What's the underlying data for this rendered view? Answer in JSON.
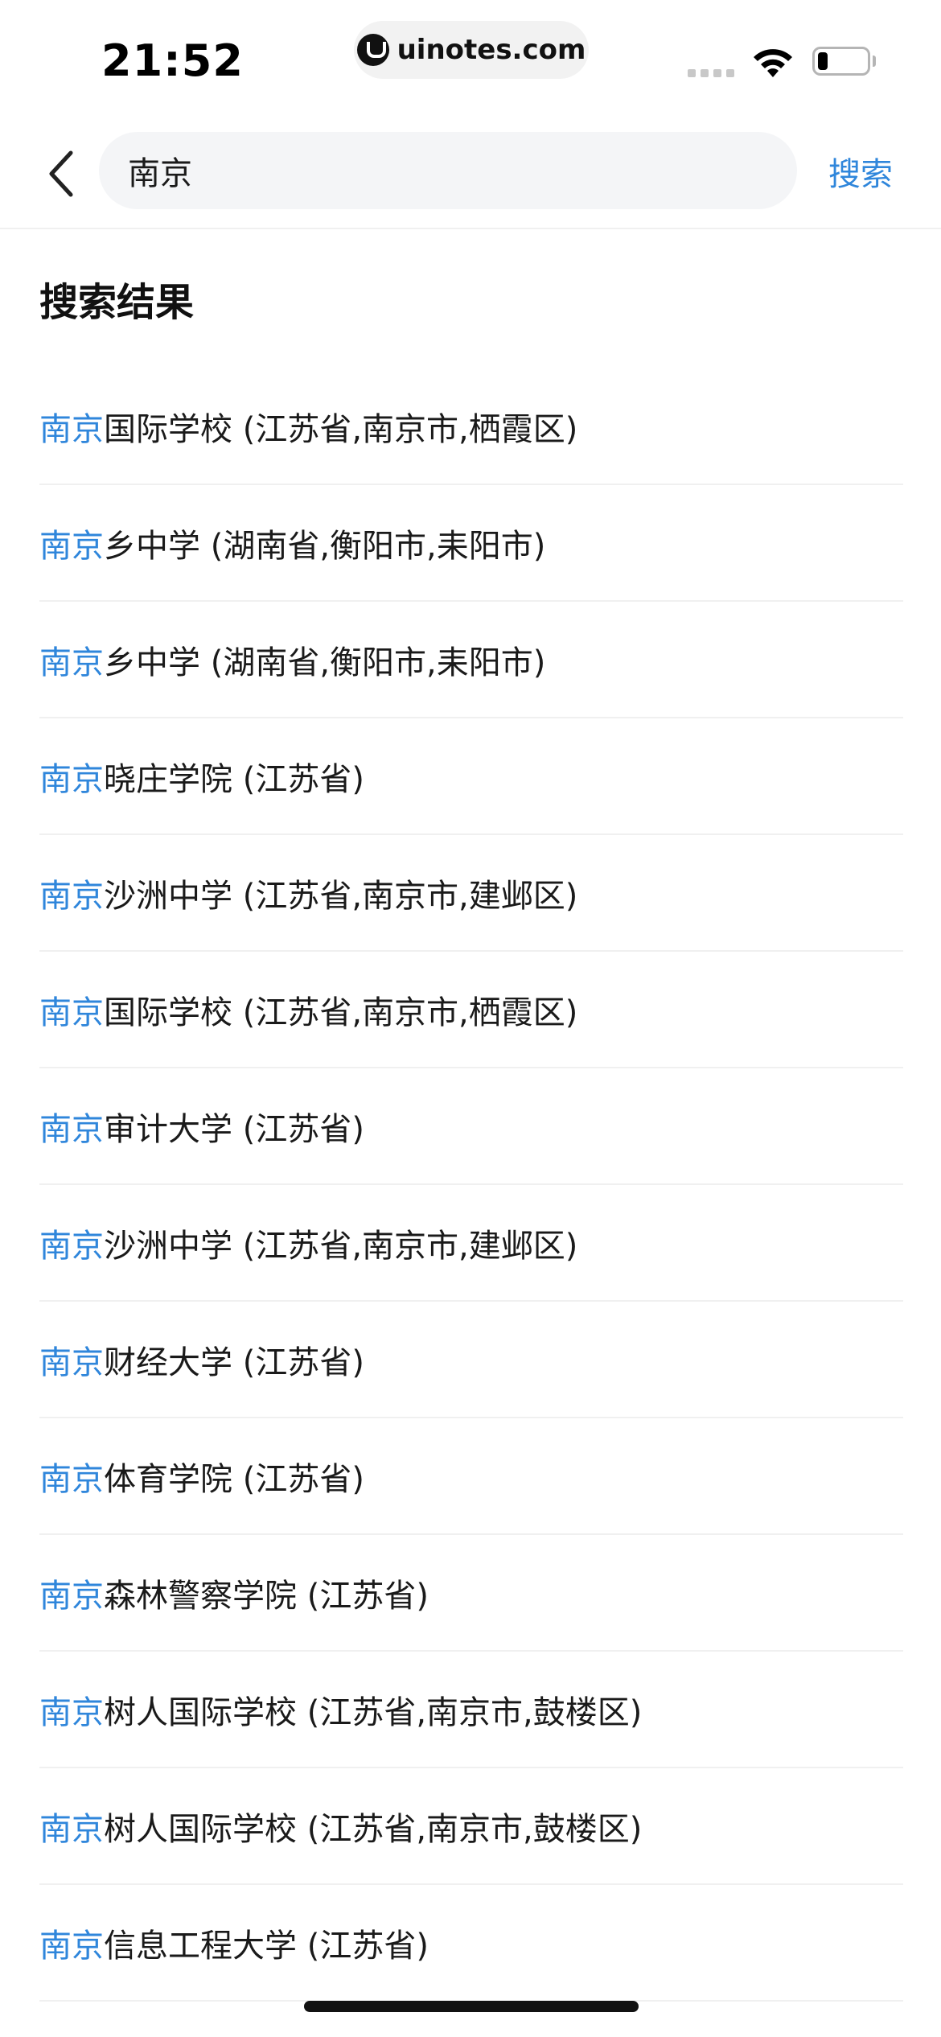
{
  "status_bar": {
    "time": "21:52",
    "url": "uinotes.com"
  },
  "search": {
    "query": "南京",
    "button_label": "搜索"
  },
  "results_title": "搜索结果",
  "highlight_color": "#2f86db",
  "results": [
    {
      "match": "南京",
      "rest": "国际学校 (江苏省,南京市,栖霞区)"
    },
    {
      "match": "南京",
      "rest": "乡中学 (湖南省,衡阳市,耒阳市)"
    },
    {
      "match": "南京",
      "rest": "乡中学 (湖南省,衡阳市,耒阳市)"
    },
    {
      "match": "南京",
      "rest": "晓庄学院 (江苏省)"
    },
    {
      "match": "南京",
      "rest": "沙洲中学 (江苏省,南京市,建邺区)"
    },
    {
      "match": "南京",
      "rest": "国际学校 (江苏省,南京市,栖霞区)"
    },
    {
      "match": "南京",
      "rest": "审计大学 (江苏省)"
    },
    {
      "match": "南京",
      "rest": "沙洲中学 (江苏省,南京市,建邺区)"
    },
    {
      "match": "南京",
      "rest": "财经大学 (江苏省)"
    },
    {
      "match": "南京",
      "rest": "体育学院 (江苏省)"
    },
    {
      "match": "南京",
      "rest": "森林警察学院 (江苏省)"
    },
    {
      "match": "南京",
      "rest": "树人国际学校 (江苏省,南京市,鼓楼区)"
    },
    {
      "match": "南京",
      "rest": "树人国际学校 (江苏省,南京市,鼓楼区)"
    },
    {
      "match": "南京",
      "rest": "信息工程大学 (江苏省)"
    }
  ]
}
